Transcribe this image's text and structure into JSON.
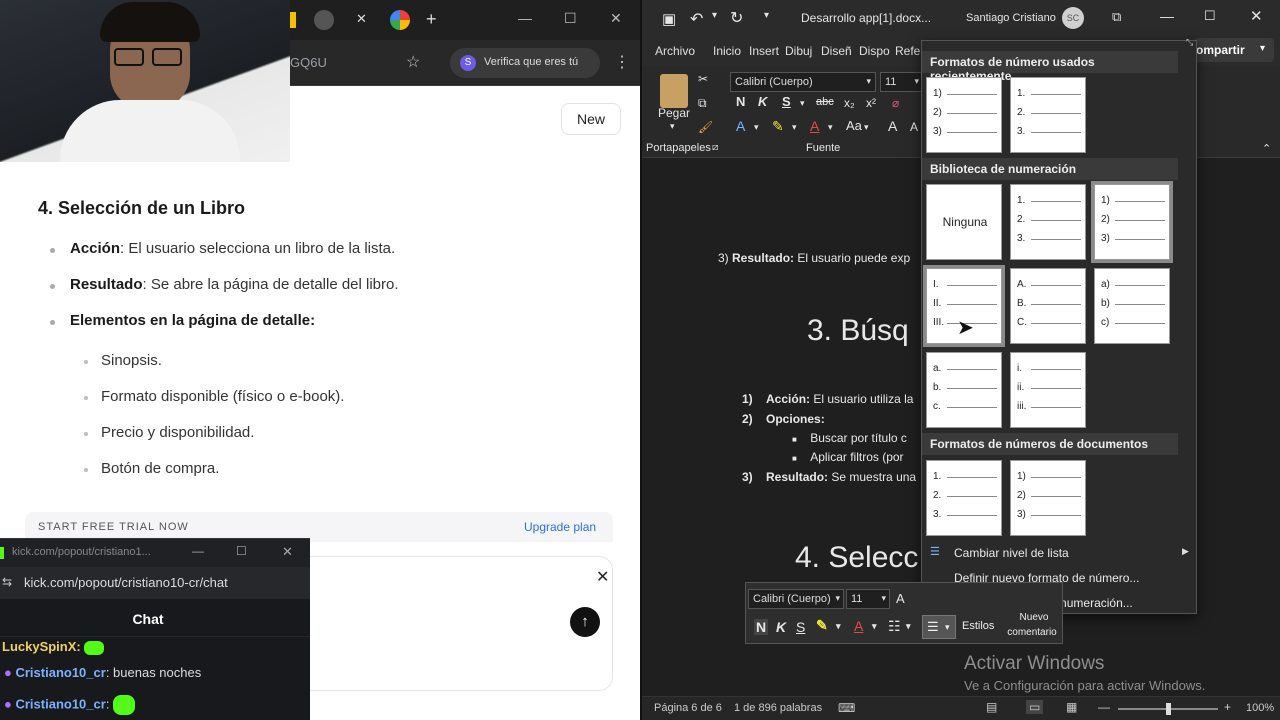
{
  "chrome": {
    "tab_close": "✕",
    "tab_new": "+",
    "url_fragment": "GQ6U",
    "verify_label": "Verifica que eres tú",
    "new_button": "New"
  },
  "article": {
    "heading": "4. Selección de un Libro",
    "items": [
      {
        "bold": "Acción",
        "text": ": El usuario selecciona un libro de la lista."
      },
      {
        "bold": "Resultado",
        "text": ": Se abre la página de detalle del libro."
      },
      {
        "bold": "Elementos en la página de detalle:",
        "text": ""
      }
    ],
    "subitems": [
      "Sinopsis.",
      "Formato disponible (físico o e-book).",
      "Precio y disponibilidad.",
      "Botón de compra."
    ],
    "trial_label": "START FREE TRIAL NOW",
    "upgrade_label": "Upgrade plan"
  },
  "kick": {
    "window_title": "kick.com/popout/cristiano1...",
    "url": "kick.com/popout/cristiano10-cr/chat",
    "chat_header": "Chat",
    "messages": [
      {
        "user": "LuckySpinX",
        "text": ""
      },
      {
        "user": "Cristiano10_cr",
        "text": "buenas noches"
      },
      {
        "user": "Cristiano10_cr",
        "text": ""
      }
    ]
  },
  "word": {
    "doc_title": "Desarrollo app[1].docx...",
    "user_name": "Santiago Cristiano",
    "user_initials": "SC",
    "share_label": "ompartir",
    "tabs": [
      "Archivo",
      "Inicio",
      "Insert",
      "Dibuj",
      "Diseñ",
      "Dispo",
      "Refer"
    ],
    "font_name": "Calibri (Cuerpo)",
    "font_size": "11",
    "paste_label": "Pegar",
    "clipboard_group": "Portapapeles",
    "font_group": "Fuente",
    "doc_lines": {
      "result3_num": "3)",
      "result3_bold": "Resultado:",
      "result3_text": "El usuario puede exp",
      "h3": "3. Búsq",
      "a1_num": "1)",
      "a1_bold": "Acción:",
      "a1_text": "El usuario utiliza la",
      "a2_num": "2)",
      "a2_bold": "Opciones:",
      "b1": "Buscar por título c",
      "b2": "Aplicar filtros (por",
      "a3_num": "3)",
      "a3_bold": "Resultado:",
      "a3_text": "Se muestra una",
      "h4": "4. Selecc"
    },
    "status": {
      "page": "Página 6 de 6",
      "words": "1 de 896 palabras",
      "zoom": "100%"
    },
    "activate_title": "Activar Windows",
    "activate_sub": "Ve a Configuración para activar Windows."
  },
  "numbering": {
    "recent_header": "Formatos de número usados recientemente",
    "library_header": "Biblioteca de numeración",
    "doc_header": "Formatos de números de documentos",
    "none_label": "Ninguna",
    "recent": [
      [
        "1)",
        "2)",
        "3)"
      ],
      [
        "1.",
        "2.",
        "3."
      ]
    ],
    "library": [
      [
        "1.",
        "2.",
        "3."
      ],
      [
        "1)",
        "2)",
        "3)"
      ],
      [
        "I.",
        "II.",
        "III."
      ],
      [
        "A.",
        "B.",
        "C."
      ],
      [
        "a)",
        "b)",
        "c)"
      ],
      [
        "a.",
        "b.",
        "c."
      ],
      [
        "i.",
        "ii.",
        "iii."
      ]
    ],
    "docs": [
      [
        "1.",
        "2.",
        "3."
      ],
      [
        "1)",
        "2)",
        "3)"
      ]
    ],
    "menu": [
      "Cambiar nivel de lista",
      "Definir nuevo formato de número...",
      "Establecer valor de numeración..."
    ]
  },
  "minibar": {
    "font": "Calibri (Cuerpo)",
    "size": "11",
    "styles": "Estilos",
    "new_comment_1": "Nuevo",
    "new_comment_2": "comentario"
  }
}
